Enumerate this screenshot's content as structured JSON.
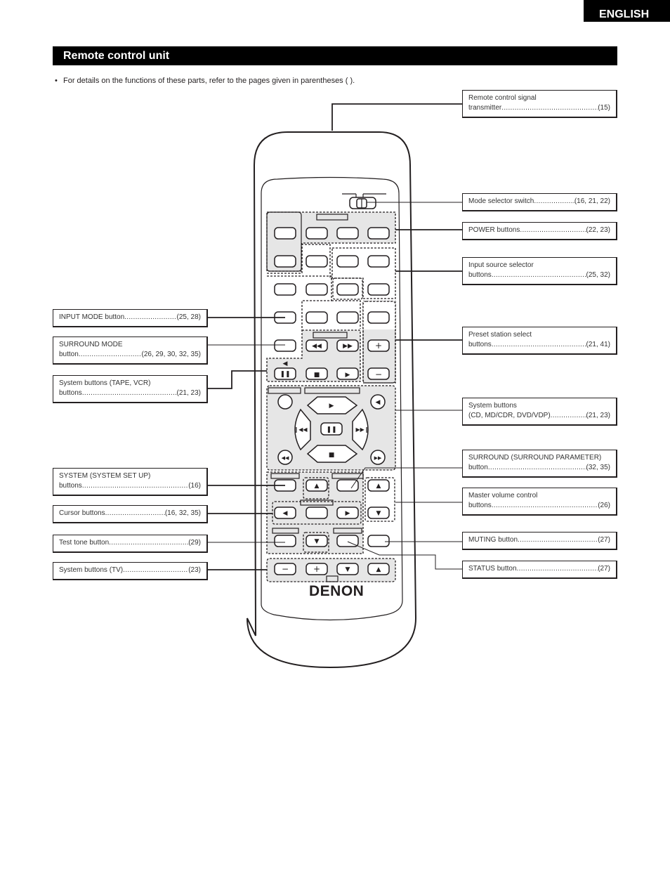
{
  "header": {
    "language_tab": "ENGLISH"
  },
  "section": {
    "title": "Remote control unit"
  },
  "intro": {
    "bullet": "•",
    "text": "For details on the functions of these parts, refer to the pages given in parentheses ( )."
  },
  "remote": {
    "brand": "DENON"
  },
  "labels_right": [
    {
      "line1": "Remote control signal",
      "name": "transmitter",
      "pages": "(15)"
    },
    {
      "line1": "",
      "name": "Mode selector switch",
      "pages": "(16, 21, 22)"
    },
    {
      "line1": "",
      "name": "POWER buttons",
      "pages": "(22, 23)"
    },
    {
      "line1": "Input source selector",
      "name": "buttons",
      "pages": "(25, 32)"
    },
    {
      "line1": "Preset station select",
      "name": "buttons",
      "pages": "(21, 41)"
    },
    {
      "line1": "System buttons",
      "name": "(CD, MD/CDR, DVD/VDP)",
      "pages": "(21, 23)"
    },
    {
      "line1": "SURROUND (SURROUND PARAMETER)",
      "name": "button",
      "pages": "(32, 35)"
    },
    {
      "line1": "Master volume control",
      "name": "buttons",
      "pages": "(26)"
    },
    {
      "line1": "",
      "name": "MUTING button",
      "pages": "(27)"
    },
    {
      "line1": "",
      "name": "STATUS button",
      "pages": "(27)"
    }
  ],
  "labels_left": [
    {
      "line1": "",
      "name": "INPUT MODE button",
      "pages": "(25, 28)"
    },
    {
      "line1": "SURROUND MODE",
      "name": "button",
      "pages": "(26, 29, 30, 32, 35)"
    },
    {
      "line1": "System buttons (TAPE, VCR)",
      "name": "buttons",
      "pages": "(21, 23)"
    },
    {
      "line1": "SYSTEM (SYSTEM SET UP)",
      "name": "buttons",
      "pages": "(16)"
    },
    {
      "line1": "",
      "name": "Cursor buttons",
      "pages": "(16, 32, 35)"
    },
    {
      "line1": "",
      "name": "Test tone button",
      "pages": "(29)"
    },
    {
      "line1": "",
      "name": "System buttons (TV)",
      "pages": "(23)"
    }
  ],
  "button_glyphs": {
    "rewind": "◀◀",
    "fast_forward": "▶▶",
    "pause": "❚❚",
    "stop": "■",
    "play": "▶",
    "reverse": "◀",
    "skip_back": "❙◀◀",
    "skip_forward": "▶▶❙",
    "up": "▲",
    "down": "▼",
    "left": "◀",
    "right": "▶",
    "plus": "+",
    "minus": "−"
  }
}
